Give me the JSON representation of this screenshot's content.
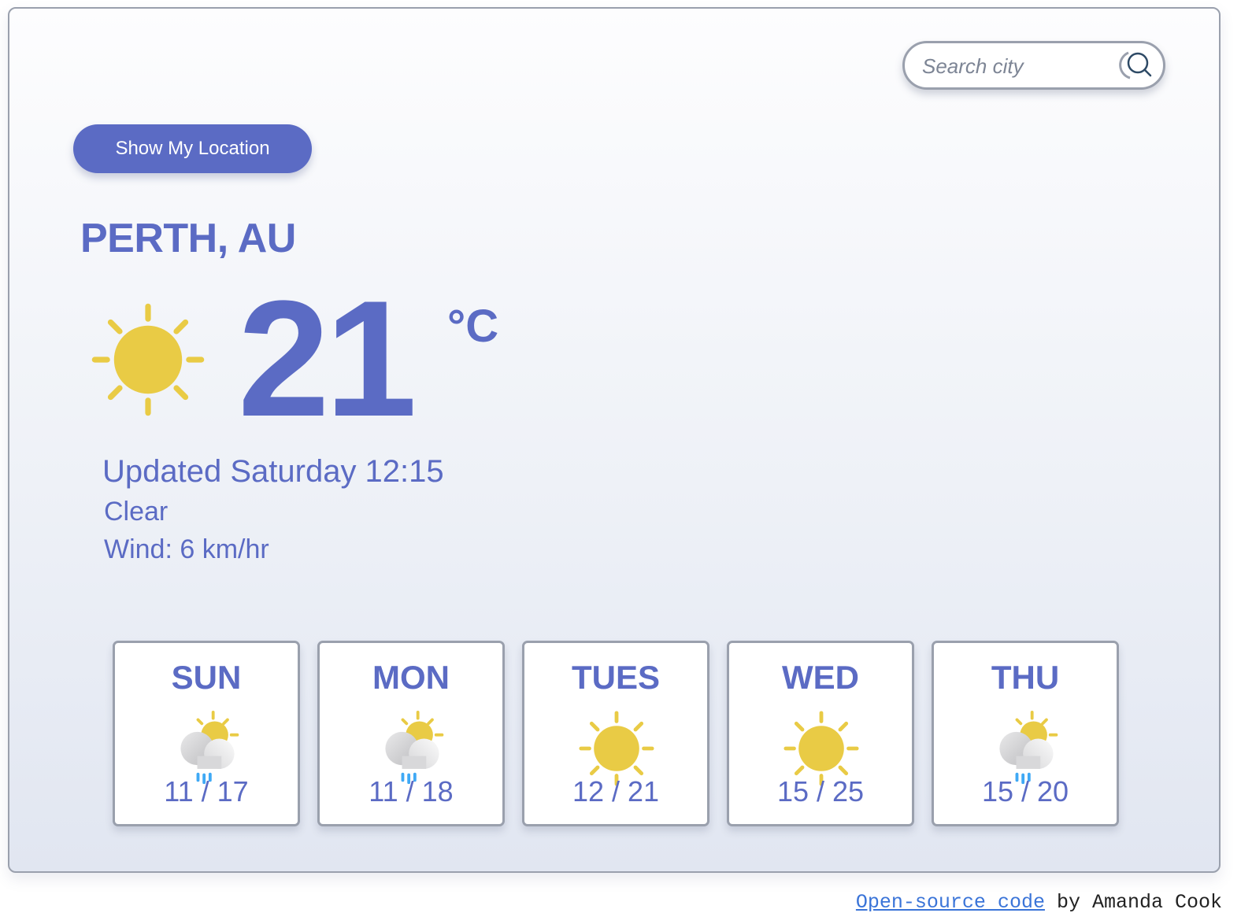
{
  "search": {
    "placeholder": "Search city",
    "value": ""
  },
  "location_button": {
    "label": "Show My Location"
  },
  "current": {
    "city": "PERTH, AU",
    "icon": "sun-icon",
    "temperature": "21",
    "unit": "°C",
    "updated": "Updated Saturday 12:15",
    "description": "Clear",
    "wind": "Wind: 6 km/hr"
  },
  "forecast": [
    {
      "day": "SUN",
      "icon": "partly-cloudy-rain-icon",
      "temps": "11 / 17"
    },
    {
      "day": "MON",
      "icon": "partly-cloudy-rain-icon",
      "temps": "11 / 18"
    },
    {
      "day": "TUES",
      "icon": "sun-icon",
      "temps": "12 / 21"
    },
    {
      "day": "WED",
      "icon": "sun-icon",
      "temps": "15 / 25"
    },
    {
      "day": "THU",
      "icon": "partly-cloudy-rain-icon",
      "temps": "15 / 20"
    }
  ],
  "footer": {
    "link": "Open-source code",
    "credit": " by Amanda Cook"
  },
  "colors": {
    "accent": "#5b6bc4",
    "sun": "#e9cb45",
    "rain": "#3fa9f5",
    "border": "#9aa0ad"
  }
}
